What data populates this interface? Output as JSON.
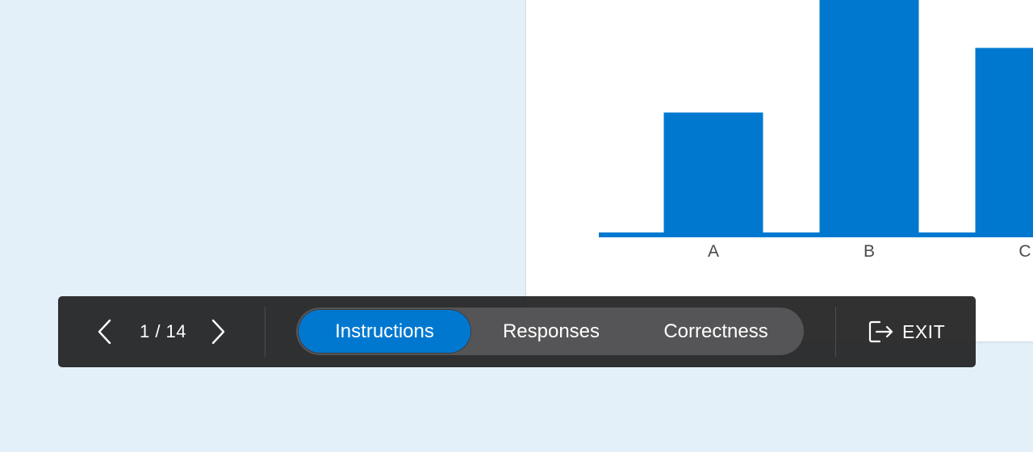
{
  "colors": {
    "background": "#e4f0f9",
    "bar": "#0078d0",
    "toolbar": "#202021",
    "segment_track": "#555557",
    "segment_active": "#0078d0"
  },
  "chart_data": {
    "type": "bar",
    "categories": [
      "A",
      "B",
      "C"
    ],
    "values": [
      0.53,
      1.03,
      0.81
    ],
    "ylim": [
      0,
      1
    ],
    "grid": false,
    "legend": "none",
    "title": "",
    "xlabel": "",
    "ylabel": ""
  },
  "toolbar": {
    "prev_icon": "chevron-left-icon",
    "next_icon": "chevron-right-icon",
    "page_indicator": "1 / 14",
    "tabs": [
      {
        "label": "Instructions",
        "active": true
      },
      {
        "label": "Responses",
        "active": false
      },
      {
        "label": "Correctness",
        "active": false
      }
    ],
    "exit_icon": "exit-icon",
    "exit_label": "EXIT"
  }
}
